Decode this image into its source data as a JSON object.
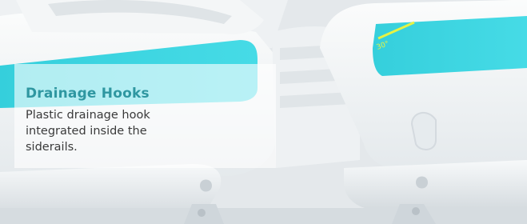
{
  "feature": {
    "title": "Drainage Hooks",
    "description": "Plastic drainage hook integrated inside the siderails."
  },
  "siderail": {
    "angle_indicator": "30°"
  },
  "colors": {
    "accent": "#2f97a1",
    "teal_panel": "#3fd3df",
    "angle_mark": "#e6f244"
  }
}
